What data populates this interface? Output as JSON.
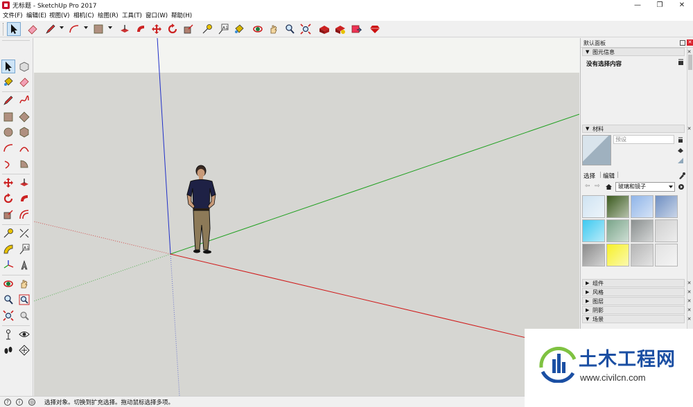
{
  "window": {
    "title": "无标题 - SketchUp Pro 2017",
    "controls": [
      "—",
      "❐",
      "✕"
    ]
  },
  "menu": [
    "文件(F)",
    "编辑(E)",
    "视图(V)",
    "相机(C)",
    "绘图(R)",
    "工具(T)",
    "窗口(W)",
    "帮助(H)"
  ],
  "toolbar": {
    "tools": [
      "select",
      "eraser",
      "pencil",
      "arc",
      "rectangle",
      "push-pull",
      "follow-me",
      "move",
      "rotate",
      "scale",
      "tape-measure",
      "text",
      "paint-bucket",
      "orbit",
      "pan",
      "zoom",
      "zoom-extents",
      "3d-warehouse",
      "extension-warehouse",
      "send-to-layout",
      "extension-manager"
    ]
  },
  "left_toolbar": {
    "tools": [
      "select",
      "component",
      "paint-bucket",
      "eraser",
      "line",
      "freehand",
      "rectangle",
      "rotated-rectangle",
      "circle",
      "polygon",
      "arc",
      "2pt-arc",
      "3pt-arc",
      "pie",
      "move",
      "push-pull",
      "rotate",
      "follow-me",
      "scale",
      "offset",
      "tape-measure",
      "text",
      "protractor",
      "dimension",
      "axes",
      "3d-text",
      "orbit",
      "pan",
      "zoom",
      "zoom-window",
      "zoom-extents",
      "previous",
      "position-camera",
      "look-around",
      "walk",
      "section-plane"
    ]
  },
  "tray": {
    "title": "默认面板",
    "entity_info": {
      "title": "图元信息",
      "message": "没有选择内容"
    },
    "materials": {
      "title": "材料",
      "name_placeholder": "预设",
      "tabs": [
        "选择",
        "编辑"
      ],
      "collection": "玻璃和镜子",
      "swatch_colors": [
        "#cfe3f2",
        "#3b5a1e",
        "#8fb4e8",
        "#6f8fc2",
        "#3ec9f0",
        "#7aa58a",
        "#8a8f8f",
        "#cfcfcf",
        "#8a8a8a",
        "#f6f028",
        "#b5b5b5",
        "#e2e2e2"
      ]
    },
    "collapsed_panels": [
      "组件",
      "风格",
      "图层",
      "阴影"
    ],
    "expanded_tail": "场景"
  },
  "status": {
    "message": "选择对象。切换到扩充选择。拖动鼠标选择多项。"
  },
  "watermark": {
    "title": "土木工程网",
    "url": "www.civilcn.com"
  },
  "colors": {
    "sky": "#f3f4f1",
    "ground": "#d6d6d2",
    "axis_red": "#d01818",
    "axis_green": "#1fa01f",
    "axis_blue": "#2030c8",
    "brand_blue": "#1b4fa3"
  }
}
